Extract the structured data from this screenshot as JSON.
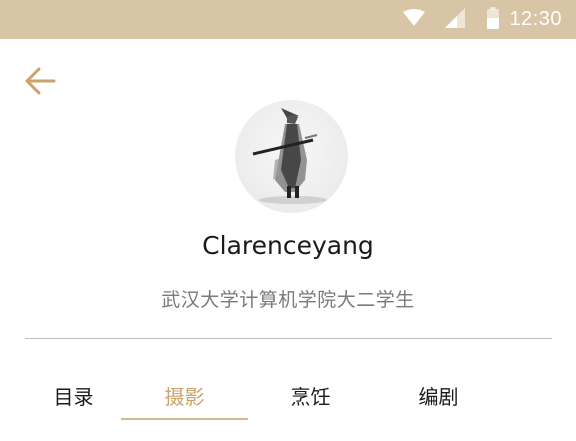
{
  "status_bar": {
    "time": "12:30",
    "icons": [
      "wifi-icon",
      "signal-icon",
      "battery-icon"
    ],
    "background": "#d8c5a5"
  },
  "nav": {
    "back_icon": "arrow-left-icon",
    "accent": "#c9a46a"
  },
  "profile": {
    "username": "Clarenceyang",
    "bio": "武汉大学计算机学院大二学生"
  },
  "tabs": [
    {
      "label": "目录",
      "active": false
    },
    {
      "label": "摄影",
      "active": true
    },
    {
      "label": "烹饪",
      "active": false
    },
    {
      "label": "编剧",
      "active": false
    }
  ]
}
